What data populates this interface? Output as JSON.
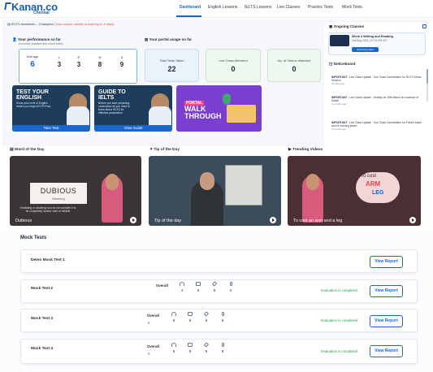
{
  "brand": {
    "name": "Kanan.co",
    "sub": "Chennai"
  },
  "nav": [
    {
      "label": "Dashboard"
    },
    {
      "label": "English Lessons"
    },
    {
      "label": "IELTS Lessons"
    },
    {
      "label": "Live Classes"
    },
    {
      "label": "Practice Tests"
    },
    {
      "label": "Mock Tests"
    }
  ],
  "course": {
    "name": "IELTS Academic – Champion",
    "note": "(Your course validity is expiring in 3 days)"
  },
  "performance": {
    "title": "Your performance so far",
    "subtitle": "(Includes practice and mock tests)",
    "scores": [
      {
        "label": "Average",
        "value": "6"
      },
      {
        "label": "L",
        "value": "3"
      },
      {
        "label": "R",
        "value": "3"
      },
      {
        "label": "W",
        "value": "8"
      },
      {
        "label": "S",
        "value": "9"
      }
    ]
  },
  "usage": {
    "title": "Your portal usage so far",
    "stats": [
      {
        "label": "Total Tests Taken",
        "value": "22"
      },
      {
        "label": "Live Class Attended",
        "value": "0"
      },
      {
        "label": "No. of Videos Watched",
        "value": "0"
      }
    ]
  },
  "promos": [
    {
      "title1": "TEST YOUR",
      "title2": "ENGLISH",
      "desc": "Know your level of English before you begin IELTS Prep",
      "button": "Take Test"
    },
    {
      "title1": "GUIDE TO",
      "title2": "IELTS",
      "desc": "Before you start preparing, understand all you need to know about IELTS for effective preparation",
      "button": "View Guide"
    }
  ],
  "walkthrough": {
    "t1": "PORTAL",
    "t2a": "WALK",
    "t2b": "THROUGH"
  },
  "ongoing": {
    "title": "Ongoing Classes",
    "class_title": "Week 4 Writing and Reading",
    "class_date": "2nd Aug 2023 | 07:00 PM IST",
    "button": "Upcoming class"
  },
  "noticeboard": {
    "title": "Noticeboard",
    "items": [
      {
        "tag": "IMPORTANT",
        "text": "Live Class Update - Live Class Cancellation for IELTS Demo Session",
        "ago": "29 days ago"
      },
      {
        "tag": "IMPORTANT",
        "text": "Live Class Update - Holiday on 16th March on occasion of Diwali",
        "ago": "4 months ago"
      },
      {
        "tag": "IMPORTANT",
        "text": "Live Class Update - Live Class Cancellation for French batch and M morning Batch",
        "ago": "4 months ago"
      }
    ]
  },
  "videos": [
    {
      "heading": "Word of the Day",
      "caption": "Dubious",
      "word": "DUBIOUS",
      "meaning": "Meaning",
      "definition": "Hesitating or doubting; you do not consider it to be completely honest, safe or reliable"
    },
    {
      "heading": "Tip of the Day",
      "caption": "Tip of the day"
    },
    {
      "heading": "Trending Videos",
      "caption": "To cost an arm and a leg",
      "t1": "To cost",
      "t2": "ARM",
      "t3": "LEG"
    }
  ],
  "mock": {
    "title": "Mock Tests",
    "overall_label": "Overall",
    "eval_text": "Evaluation is completed",
    "button": "View Report",
    "tests": [
      {
        "name": "Demo Mock Test 1"
      },
      {
        "name": "Mock Test 2",
        "overall": "",
        "skills": [
          "4",
          "0",
          "5",
          "4"
        ]
      },
      {
        "name": "Mock Test 3",
        "overall": "9",
        "skills": [
          "9",
          "9",
          "9",
          "9"
        ]
      },
      {
        "name": "Mock Test 4",
        "overall": "9",
        "skills": [
          "9",
          "9",
          "9",
          "9"
        ]
      }
    ]
  },
  "colors": {
    "accent": "#1a66c9",
    "success": "#2d9a4a",
    "warning": "#e0503a"
  }
}
